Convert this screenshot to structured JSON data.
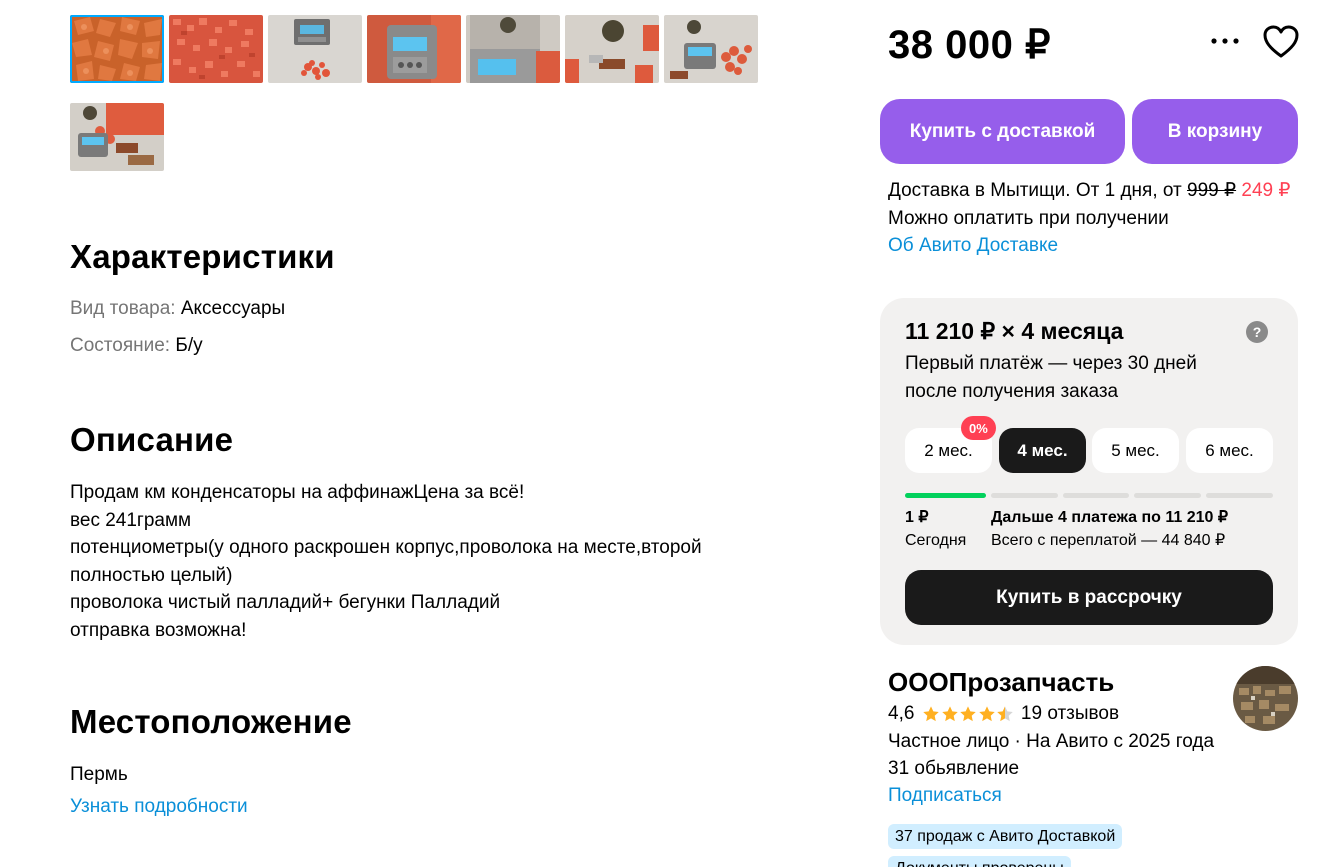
{
  "gallery": {
    "thumbnails": [
      "photo-1",
      "photo-2",
      "photo-3",
      "photo-4",
      "photo-5",
      "photo-6",
      "photo-7",
      "photo-8"
    ],
    "active_index": 0
  },
  "characteristics": {
    "title": "Характеристики",
    "rows": [
      {
        "key": "Вид товара:",
        "value": "Аксессуары"
      },
      {
        "key": "Состояние:",
        "value": "Б/у"
      }
    ]
  },
  "description": {
    "title": "Описание",
    "lines": [
      "Продам км конденсаторы на аффинажЦена за всё!",
      "вес 241грамм",
      "потенциометры(у одного раскрошен корпус,проволока на месте,второй",
      "полностью целый)",
      "проволока чистый палладий+ бегунки Палладий",
      "отправка возможна!"
    ]
  },
  "location": {
    "title": "Местоположение",
    "city": "Пермь",
    "details_link": "Узнать подробности"
  },
  "price": {
    "value": "38 000 ₽",
    "more_icon": "more-dots-icon",
    "favorite_icon": "heart-icon"
  },
  "actions": {
    "buy_with_delivery": "Купить с доставкой",
    "add_to_cart": "В корзину"
  },
  "delivery": {
    "text": "Доставка в Мытищи. От 1 дня, от",
    "old_price": "999 ₽",
    "new_price": "249 ₽",
    "payment_note": "Можно оплатить при получении",
    "about_link": "Об Авито Доставке"
  },
  "installment": {
    "title": "11 210 ₽ × 4 месяца",
    "subtitle": "Первый платёж — через 30 дней после получения заказа",
    "help_icon": "?",
    "terms": [
      "2 мес.",
      "4 мес.",
      "5 мес.",
      "6 мес."
    ],
    "selected_index": 1,
    "badge": "0%",
    "progress": {
      "segments": 5,
      "paid": 1
    },
    "first_payment": "1 ₽",
    "first_payment_when": "Сегодня",
    "next_payments": "Дальше 4 платежа по 11 210 ₽",
    "total": "Всего с переплатой — 44 840 ₽",
    "buy_button": "Купить в рассрочку"
  },
  "seller": {
    "name": "ОООПрозапчасть",
    "rating": "4,6",
    "stars": 4.5,
    "reviews": "19 отзывов",
    "type_since": "Частное лицо · На Авито с 2025 года",
    "listings": "31 обьявление",
    "subscribe": "Подписаться",
    "tags": [
      "37 продаж с Авито Доставкой",
      "Документы проверены"
    ]
  },
  "colors": {
    "accent_purple": "#965eeb",
    "link_blue": "#0a8fd8",
    "sale_red": "#ff4053",
    "progress_green": "#02d15c",
    "star_yellow": "#ffb021"
  }
}
